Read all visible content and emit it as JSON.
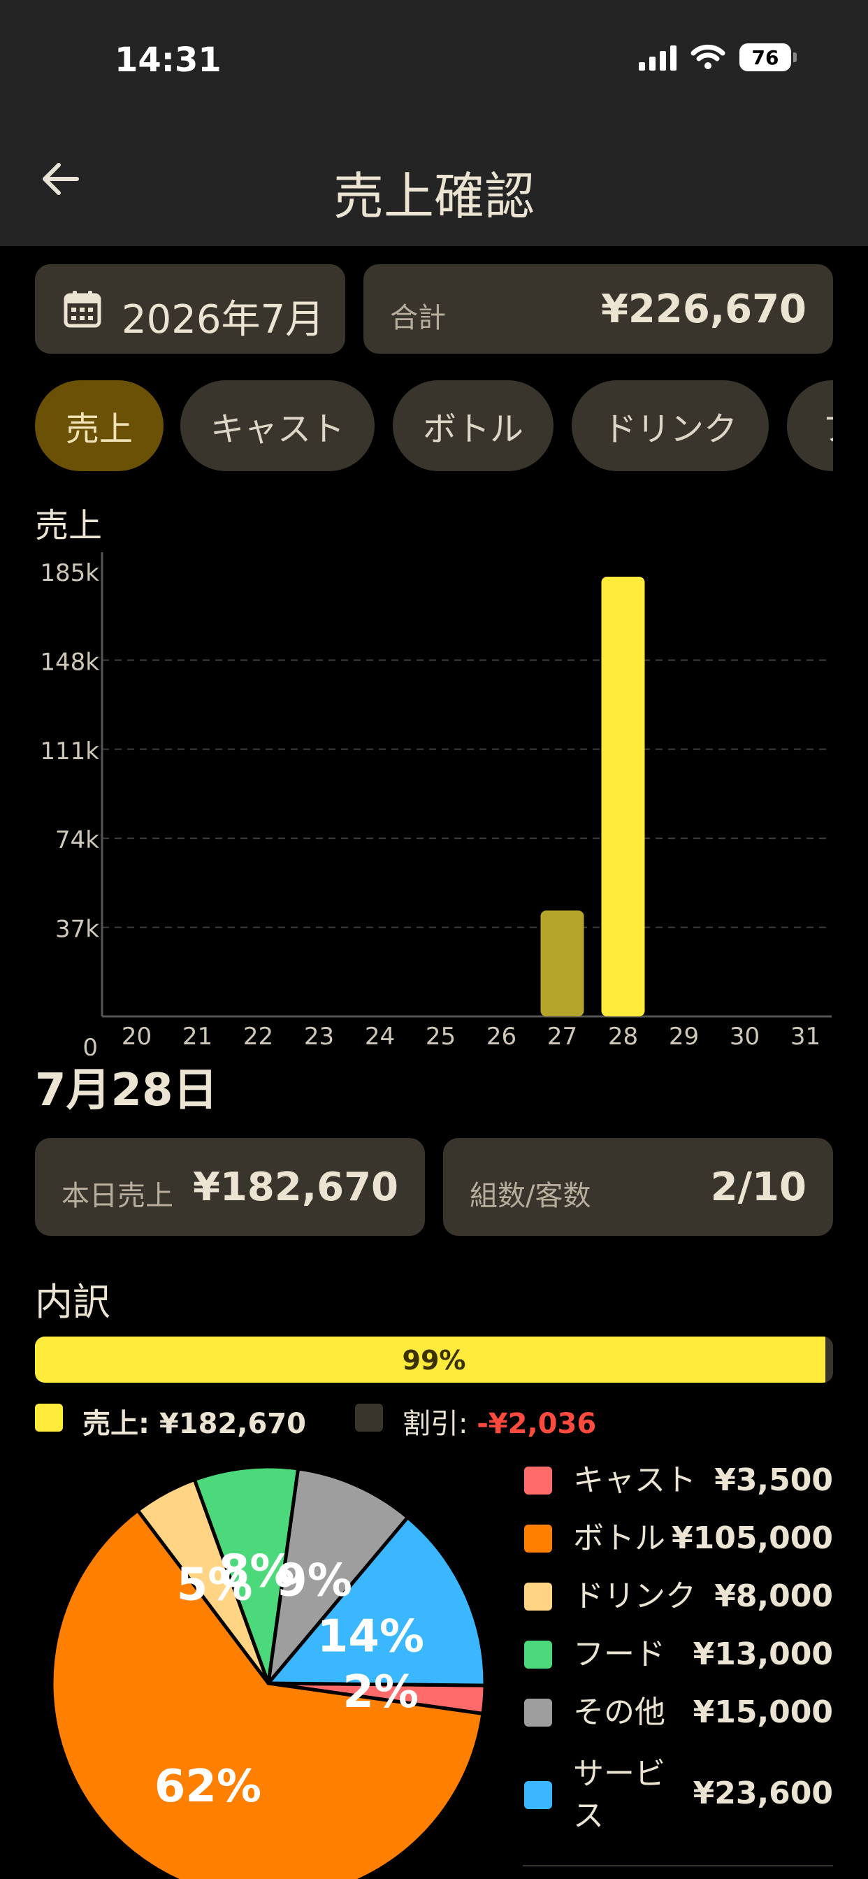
{
  "status_bar": {
    "time": "14:31",
    "battery": "76"
  },
  "header": {
    "title": "売上確認"
  },
  "month_selector": {
    "label": "2026年7月"
  },
  "total": {
    "label": "合計",
    "value": "¥226,670"
  },
  "tabs": [
    {
      "label": "売上",
      "active": true
    },
    {
      "label": "キャスト"
    },
    {
      "label": "ボトル"
    },
    {
      "label": "ドリンク"
    },
    {
      "label": "フ"
    }
  ],
  "chart_data": {
    "type": "bar",
    "title": "売上",
    "categories": [
      "20",
      "21",
      "22",
      "23",
      "24",
      "25",
      "26",
      "27",
      "28",
      "29",
      "30",
      "31"
    ],
    "values": [
      0,
      0,
      0,
      0,
      0,
      0,
      0,
      44000,
      182670,
      0,
      0,
      0
    ],
    "y_ticks": [
      "0",
      "37k",
      "74k",
      "111k",
      "148k",
      "185k"
    ],
    "ylim": [
      0,
      185000
    ],
    "selected_category": "28",
    "grid": "dashed horizontal",
    "colors": {
      "selected": "#ffeb3b",
      "other": "#b5a42a"
    }
  },
  "day": {
    "heading": "7月28日",
    "sales_label": "本日売上",
    "sales_value": "¥182,670",
    "groups_label": "組数/客数",
    "groups_value": "2/10"
  },
  "breakdown": {
    "heading": "内訳",
    "progress_percent": 99,
    "progress_label": "99%",
    "legend": [
      {
        "label": "売上: ¥182,670",
        "color": "#ffeb3b"
      },
      {
        "label_prefix": "割引: ",
        "value": "-¥2,036",
        "color": "#3a352c",
        "value_color": "#ff4b3e"
      }
    ]
  },
  "pie": {
    "slices": [
      {
        "name": "キャスト",
        "value": "¥3,500",
        "amount": 3500,
        "percent_label": "2%",
        "color": "#ff6b6b"
      },
      {
        "name": "ボトル",
        "value": "¥105,000",
        "amount": 105000,
        "percent_label": "62%",
        "color": "#ff7f00"
      },
      {
        "name": "ドリンク",
        "value": "¥8,000",
        "amount": 8000,
        "percent_label": "5%",
        "color": "#ffd484"
      },
      {
        "name": "フード",
        "value": "¥13,000",
        "amount": 13000,
        "percent_label": "8%",
        "color": "#4cd97b"
      },
      {
        "name": "その他",
        "value": "¥15,000",
        "amount": 15000,
        "percent_label": "9%",
        "color": "#9e9e9e"
      },
      {
        "name": "サービス",
        "value": "¥23,600",
        "amount": 23600,
        "percent_label": "14%",
        "color": "#3ab7ff"
      }
    ]
  }
}
